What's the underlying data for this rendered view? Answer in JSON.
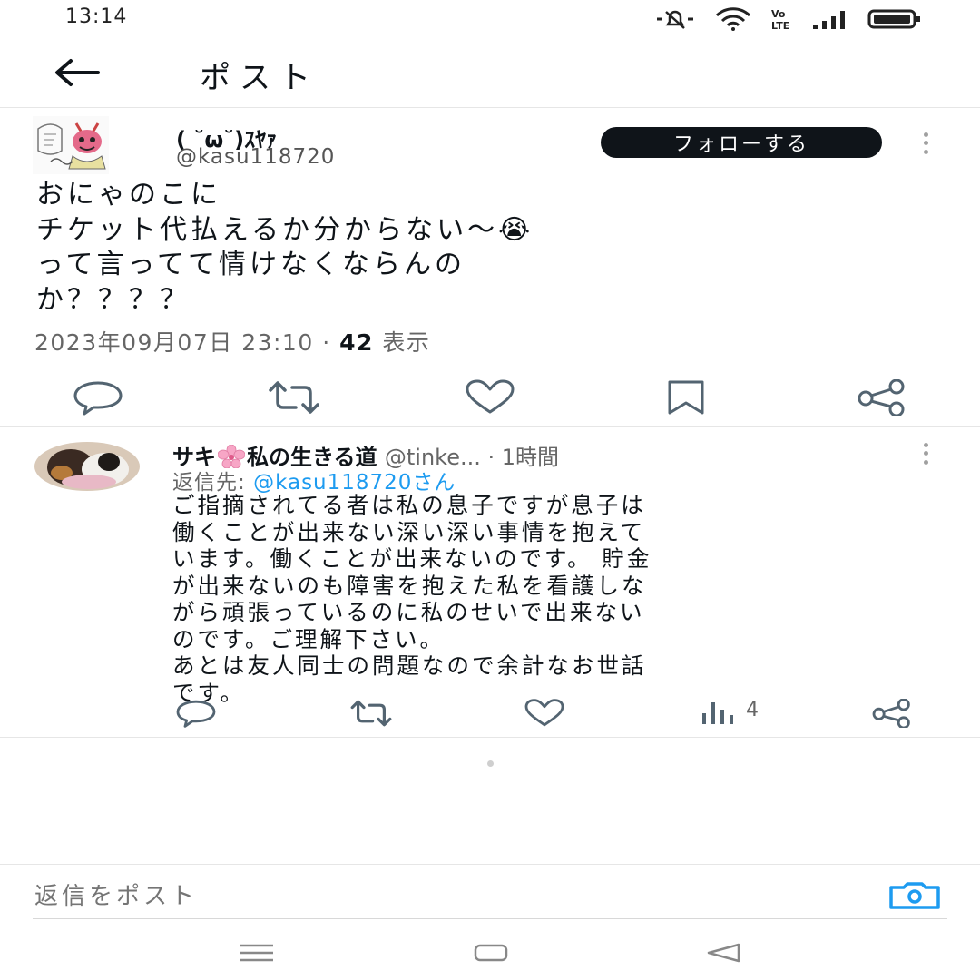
{
  "status_bar": {
    "time": "13:14",
    "icons": [
      "mute-icon",
      "wifi-icon",
      "volte-icon",
      "signal-icon",
      "battery-icon"
    ]
  },
  "header": {
    "back_icon": "arrow-left-icon",
    "title": "ポスト"
  },
  "main_post": {
    "display_name": "( ˘ω˘)ｽﾔｧ",
    "handle": "@kasu118720",
    "follow_label": "フォローする",
    "body": "おにゃのこに\nチケット代払えるか分からない〜😭\nって言ってて情けなくならんの\nか？？？？",
    "timestamp": "2023年09月07日 23:10",
    "view_count": "42",
    "view_label": "表示",
    "actions": [
      "reply-icon",
      "repost-icon",
      "like-icon",
      "bookmark-icon",
      "share-icon"
    ]
  },
  "reply": {
    "display_name_pre": "サキ",
    "display_name_post": "私の生きる道",
    "handle": "@tinke...",
    "time": "· 1時間",
    "reply_to_prefix": "返信先: ",
    "reply_to_handle": "@kasu118720さん",
    "body": "ご指摘されてる者は私の息子ですが息子は\n働くことが出来ない深い深い事情を抱えて\nいます。働くことが出来ないのです。 貯金\nが出来ないのも障害を抱えた私を看護しな\nがら頑張っているのに私のせいで出来ない\nのです。ご理解下さい。\nあとは友人同士の問題なので余計なお世話\nです。",
    "views": "4",
    "actions": [
      "reply-icon",
      "repost-icon",
      "like-icon",
      "views-icon",
      "share-icon"
    ]
  },
  "compose": {
    "placeholder": "返信をポスト",
    "camera_icon": "camera-icon"
  },
  "nav_bar": [
    "menu-icon",
    "home-icon",
    "back-triangle-icon"
  ],
  "colors": {
    "link": "#1d9bf0",
    "button_dark": "#0f1419",
    "muted": "#666666"
  }
}
